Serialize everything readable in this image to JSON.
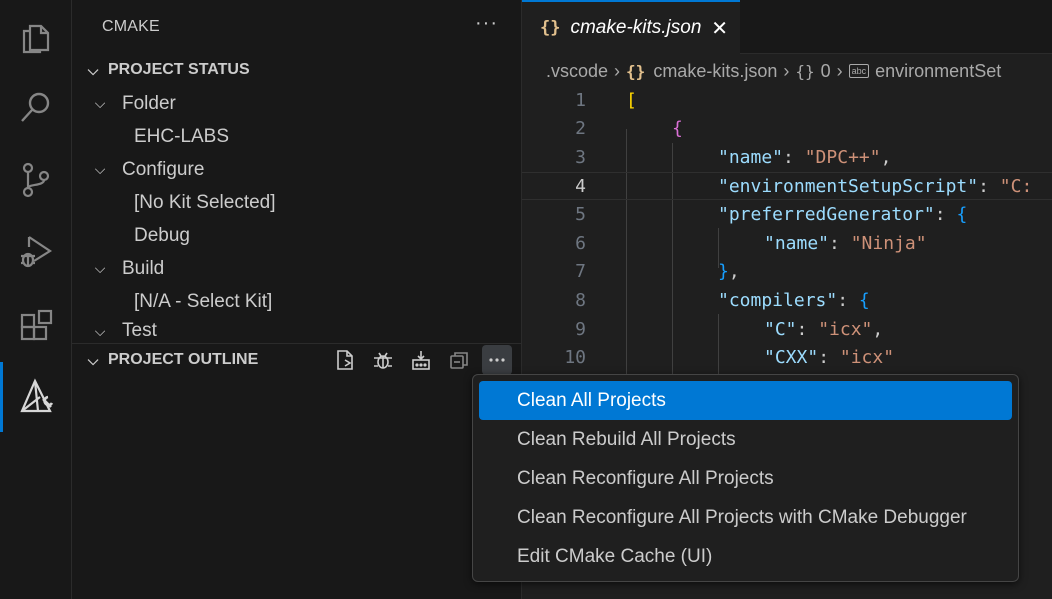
{
  "activity_bar": {
    "items": [
      {
        "icon": "explorer-icon"
      },
      {
        "icon": "search-icon"
      },
      {
        "icon": "source-control-icon"
      },
      {
        "icon": "run-debug-icon"
      },
      {
        "icon": "extensions-icon"
      },
      {
        "icon": "cmake-icon",
        "active": true
      }
    ]
  },
  "sidebar": {
    "title": "CMAKE",
    "more": "···",
    "project_status": {
      "header": "PROJECT STATUS",
      "rows": [
        {
          "label": "Folder",
          "expandable": true
        },
        {
          "label": "EHC-LABS",
          "expandable": false
        },
        {
          "label": "Configure",
          "expandable": true
        },
        {
          "label": "[No Kit Selected]",
          "expandable": false
        },
        {
          "label": "Debug",
          "expandable": false
        },
        {
          "label": "Build",
          "expandable": true
        },
        {
          "label": "[N/A - Select Kit]",
          "expandable": false
        },
        {
          "label": "Test",
          "expandable": true
        }
      ]
    },
    "project_outline": {
      "header": "PROJECT OUTLINE",
      "tools": [
        "configure-icon",
        "debug-icon",
        "build-icon",
        "collapse-all-icon",
        "more-actions-icon"
      ]
    }
  },
  "editor": {
    "tab": {
      "icon": "{}",
      "label": "cmake-kits.json",
      "close": "✕"
    },
    "breadcrumb": {
      "folder": ".vscode",
      "file_icon": "{}",
      "file": "cmake-kits.json",
      "obj_icon": "{}",
      "index": "0",
      "abc_icon": "abc",
      "prop": "environmentSet"
    },
    "line_numbers": [
      "1",
      "2",
      "3",
      "4",
      "5",
      "6",
      "7",
      "8",
      "9",
      "10"
    ],
    "current_line": 4,
    "code": {
      "l1": "[",
      "l2": "{",
      "l3_key": "\"name\"",
      "l3_val": "\"DPC++\"",
      "l4_key": "\"environmentSetupScript\"",
      "l4_val": "\"C:",
      "l5_key": "\"preferredGenerator\"",
      "l5_brace": "{",
      "l6_key": "\"name\"",
      "l6_val": "\"Ninja\"",
      "l7": "},",
      "l8_key": "\"compilers\"",
      "l8_brace": "{",
      "l9_key": "\"C\"",
      "l9_val": "\"icx\"",
      "l10_key": "\"CXX\"",
      "l10_val": "\"icx\""
    }
  },
  "context_menu": {
    "items": [
      {
        "label": "Clean All Projects",
        "selected": true
      },
      {
        "label": "Clean Rebuild All Projects"
      },
      {
        "label": "Clean Reconfigure All Projects"
      },
      {
        "label": "Clean Reconfigure All Projects with CMake Debugger"
      },
      {
        "label": "Edit CMake Cache (UI)"
      }
    ]
  },
  "colors": {
    "accent": "#0078d4",
    "json_icon": "#e2c08d",
    "key": "#9cdcfe",
    "string": "#ce9178"
  }
}
